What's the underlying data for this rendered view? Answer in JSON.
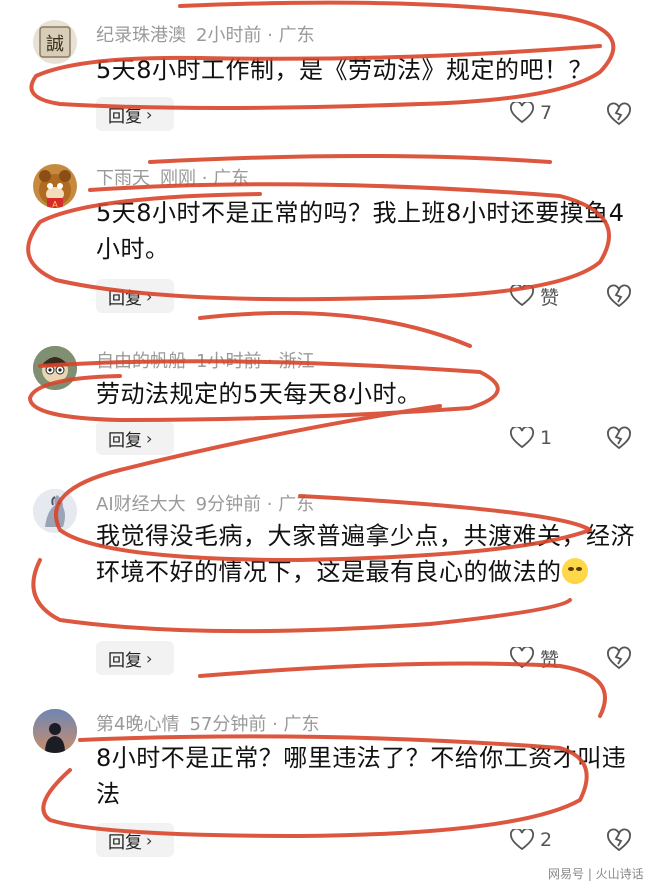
{
  "comments": [
    {
      "name": "纪录珠港澳",
      "time": "2小时前",
      "location": "广东",
      "text": "5天8小时工作制，是《劳动法》规定的吧！？",
      "reply_label": "回复",
      "likes": "7",
      "avatar_icon": "seal-avatar"
    },
    {
      "name": "下雨天",
      "time": "刚刚",
      "location": "广东",
      "text": "5天8小时不是正常的吗？我上班8小时还要摸鱼4小时。",
      "reply_label": "回复",
      "likes": "赞",
      "avatar_icon": "chipmunk-avatar"
    },
    {
      "name": "自由的帆船",
      "time": "1小时前",
      "location": "浙江",
      "text": "劳动法规定的5天每天8小时。",
      "reply_label": "回复",
      "likes": "1",
      "avatar_icon": "character-avatar"
    },
    {
      "name": "AI财经大大",
      "time": "9分钟前",
      "location": "广东",
      "text": "我觉得没毛病，大家普遍拿少点，共渡难关，经济环境不好的情况下，这是最有良心的做法的",
      "reply_label": "回复",
      "likes": "赞",
      "avatar_icon": "horse-avatar"
    },
    {
      "name": "第4晚心情",
      "time": "57分钟前",
      "location": "广东",
      "text": "8小时不是正常？哪里违法了？不给你工资才叫违法",
      "reply_label": "回复",
      "likes": "2",
      "avatar_icon": "person-avatar"
    }
  ],
  "watermark": "网易号 | 火山诗话",
  "colors": {
    "scribble": "#d9452b",
    "meta": "#9a9a9a",
    "reply_bg": "#f2f2f2"
  }
}
